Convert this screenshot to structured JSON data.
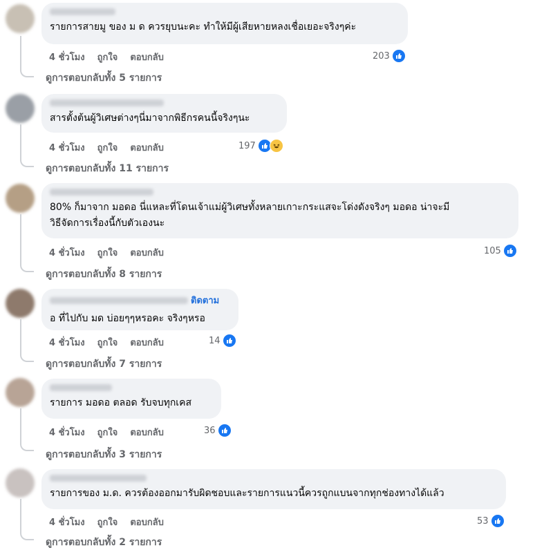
{
  "colors": {
    "bubble": "#f0f2f5",
    "like": "#1877f2",
    "meta": "#65676b",
    "follow": "#216fdb"
  },
  "comments": [
    {
      "text": "รายการสายมู ของ ม ด ควรยุบนะคะ ทำให้มีผู้เสียหายหลงเชื่อเยอะจริงๆค่ะ",
      "time": "4 ชั่วโมง",
      "like": "ถูกใจ",
      "reply": "ตอบกลับ",
      "count": "203",
      "reactions": [
        "like-icon"
      ],
      "replies": "ดูการตอบกลับทั้ง 5 รายการ"
    },
    {
      "text": "สารตั้งต้นผู้วิเศษต่างๆนี่มาจากพิธีกรคนนี้จริงๆนะ",
      "time": "4 ชั่วโมง",
      "like": "ถูกใจ",
      "reply": "ตอบกลับ",
      "count": "197",
      "reactions": [
        "like-icon",
        "haha-icon"
      ],
      "replies": "ดูการตอบกลับทั้ง 11 รายการ"
    },
    {
      "text_line1": "80% ก็มาจาก มอดอ นี่แหละที่โดนเจ้าแม่ผู้วิเศษทั้งหลายเกาะกระแสจะโด่งดังจริงๆ มอดอ น่าจะมี",
      "text_line2": "วิธีจัดการเรื่องนี้กับตัวเองนะ",
      "time": "4 ชั่วโมง",
      "like": "ถูกใจ",
      "reply": "ตอบกลับ",
      "count": "105",
      "reactions": [
        "like-icon"
      ],
      "replies": "ดูการตอบกลับทั้ง 8 รายการ"
    },
    {
      "follow": "ติดตาม",
      "text": "อ ที่ไปกับ มด บ่อยๆๆหรอคะ จริงๆหรอ",
      "time": "4 ชั่วโมง",
      "like": "ถูกใจ",
      "reply": "ตอบกลับ",
      "count": "14",
      "reactions": [
        "like-icon"
      ],
      "replies": "ดูการตอบกลับทั้ง 7 รายการ"
    },
    {
      "text": "รายการ มอดอ ตลอด รับจบทุกเคส",
      "time": "4 ชั่วโมง",
      "like": "ถูกใจ",
      "reply": "ตอบกลับ",
      "count": "36",
      "reactions": [
        "like-icon"
      ],
      "replies": "ดูการตอบกลับทั้ง 3 รายการ"
    },
    {
      "text": "รายการของ ม.ด. ควรต้องออกมารับผิดชอบและรายการแนวนี้ควรถูกแบนจากทุกช่องทางได้แล้ว",
      "time": "4 ชั่วโมง",
      "like": "ถูกใจ",
      "reply": "ตอบกลับ",
      "count": "53",
      "reactions": [
        "like-icon"
      ],
      "replies": "ดูการตอบกลับทั้ง 2 รายการ"
    }
  ]
}
